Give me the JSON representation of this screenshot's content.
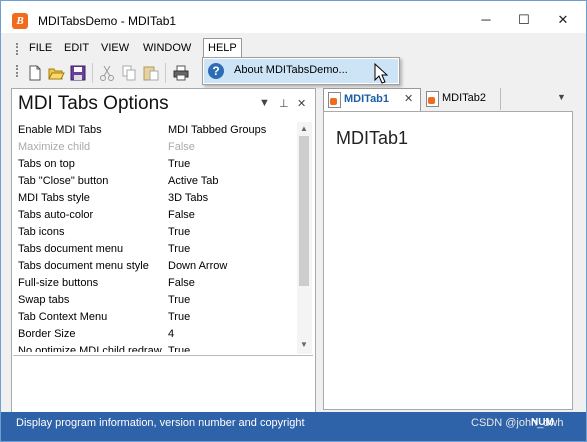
{
  "window": {
    "title": "MDITabsDemo - MDITab1",
    "app_icon_letter": "B"
  },
  "window_controls": {
    "minimize": "─",
    "maximize": "☐",
    "close": "✕"
  },
  "menu": [
    {
      "label": "FILE"
    },
    {
      "label": "EDIT"
    },
    {
      "label": "VIEW"
    },
    {
      "label": "WINDOW"
    },
    {
      "label": "HELP"
    }
  ],
  "help_menu": {
    "items": [
      {
        "label": "About MDITabsDemo..."
      }
    ]
  },
  "toolbar": {
    "buttons": [
      "new-icon",
      "open-icon",
      "save-icon",
      "cut-icon",
      "copy-icon",
      "paste-icon",
      "print-icon"
    ]
  },
  "options_panel": {
    "title": "MDI Tabs Options",
    "buttons": {
      "dropdown": "▼",
      "pin": "⊥",
      "close": "✕"
    },
    "rows": [
      {
        "name": "Enable MDI Tabs",
        "value": "MDI Tabbed Groups",
        "disabled": false
      },
      {
        "name": "Maximize child",
        "value": "False",
        "disabled": true
      },
      {
        "name": "Tabs on top",
        "value": "True",
        "disabled": false
      },
      {
        "name": "Tab \"Close\" button",
        "value": "Active Tab",
        "disabled": false
      },
      {
        "name": "MDI Tabs style",
        "value": "3D Tabs",
        "disabled": false
      },
      {
        "name": "Tabs auto-color",
        "value": "False",
        "disabled": false
      },
      {
        "name": "Tab icons",
        "value": "True",
        "disabled": false
      },
      {
        "name": "Tabs document menu",
        "value": "True",
        "disabled": false
      },
      {
        "name": "Tabs document menu style",
        "value": "Down Arrow",
        "disabled": false
      },
      {
        "name": "Full-size buttons",
        "value": "False",
        "disabled": false
      },
      {
        "name": "Swap tabs",
        "value": "True",
        "disabled": false
      },
      {
        "name": "Tab Context Menu",
        "value": "True",
        "disabled": false
      },
      {
        "name": "Border Size",
        "value": "4",
        "disabled": false
      },
      {
        "name": "No optimize MDI child redraw",
        "value": "True",
        "disabled": false
      }
    ]
  },
  "document": {
    "tabs": [
      {
        "label": "MDITab1",
        "active": true
      },
      {
        "label": "MDITab2",
        "active": false
      }
    ],
    "tab_close": "✕",
    "tab_menu": "▼",
    "content": "MDITab1"
  },
  "status_bar": {
    "text": "Display program information, version number and copyright",
    "indicator": "NUM",
    "watermark": "CSDN @john_dwh"
  },
  "colors": {
    "accent": "#2e62a9",
    "highlight": "#cde4f7",
    "app_icon": "#f26b1d"
  }
}
